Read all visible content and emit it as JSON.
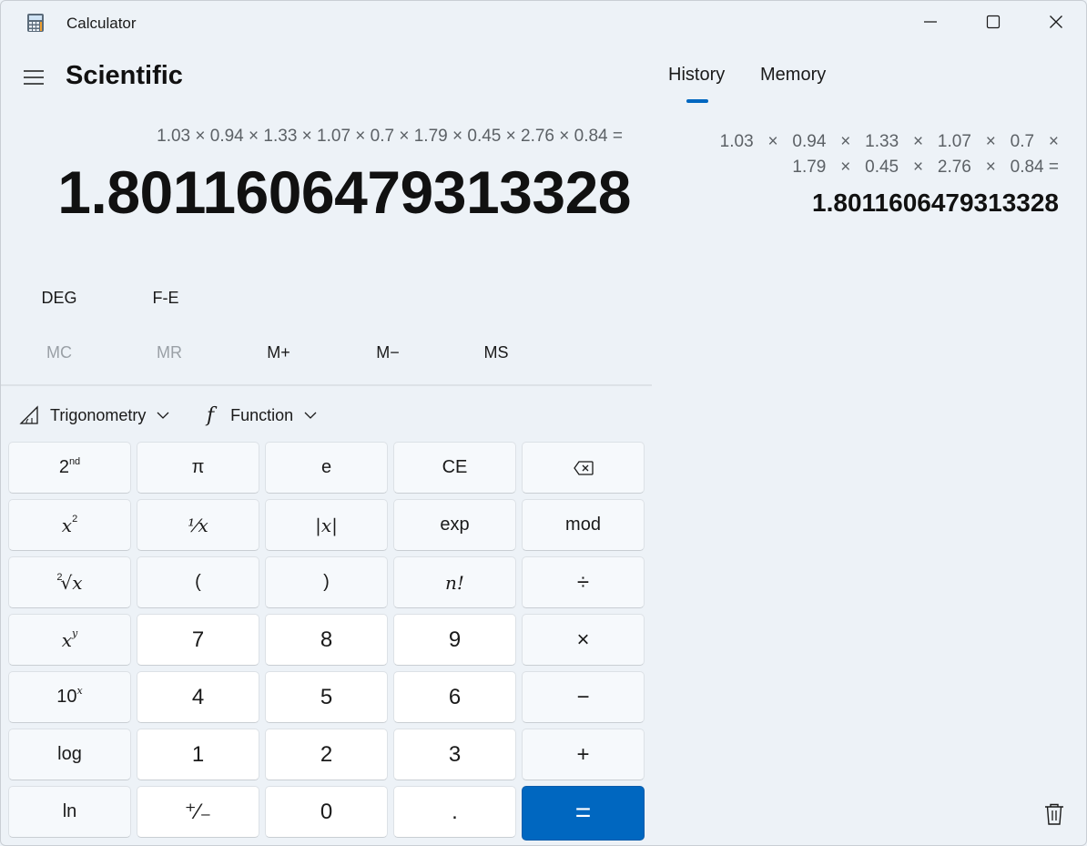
{
  "window": {
    "title": "Calculator",
    "icons": [
      "calculator-icon",
      "minimize-icon",
      "maximize-icon",
      "close-icon"
    ]
  },
  "header": {
    "mode_title": "Scientific",
    "menu_icon": "hamburger-icon"
  },
  "display": {
    "expression": "1.03 × 0.94 × 1.33 × 1.07 × 0.7 × 1.79 × 0.45 × 2.76 × 0.84 =",
    "result": "1.8011606479313328"
  },
  "options": {
    "angle_unit": "DEG",
    "fe": "F-E"
  },
  "memory_buttons": {
    "mc": "MC",
    "mr": "MR",
    "mplus": "M+",
    "mminus": "M−",
    "ms": "MS"
  },
  "function_bar": {
    "trigonometry": "Trigonometry",
    "function": "Function",
    "function_glyph": "f"
  },
  "keypad": {
    "r1": [
      "2nd",
      "π",
      "e",
      "CE",
      "backspace"
    ],
    "r2": [
      "x²",
      "⅟x",
      "|x|",
      "exp",
      "mod"
    ],
    "r3": [
      "²√x",
      "(",
      ")",
      "n!",
      "÷"
    ],
    "r4": [
      "xʸ",
      "7",
      "8",
      "9",
      "×"
    ],
    "r5": [
      "10ˣ",
      "4",
      "5",
      "6",
      "−"
    ],
    "r6": [
      "log",
      "1",
      "2",
      "3",
      "+"
    ],
    "r7": [
      "ln",
      "+/−",
      "0",
      ".",
      "="
    ],
    "labels": {
      "second": "2",
      "second_sup": "nd",
      "pi": "π",
      "e": "e",
      "ce": "CE",
      "x": "x",
      "sq_sup": "2",
      "recip": "⅟x",
      "abs": "|x|",
      "exp": "exp",
      "mod": "mod",
      "root_idx": "2",
      "root": "√x",
      "lparen": "(",
      "rparen": ")",
      "fact": "n!",
      "div": "÷",
      "pow_sup": "y",
      "seven": "7",
      "eight": "8",
      "nine": "9",
      "mul": "×",
      "ten": "10",
      "ten_sup": "x",
      "four": "4",
      "five": "5",
      "six": "6",
      "minus": "−",
      "log": "log",
      "one": "1",
      "two": "2",
      "three": "3",
      "plus": "+",
      "ln": "ln",
      "negate": "⁺∕₋",
      "zero": "0",
      "dot": ".",
      "equals": "="
    }
  },
  "history_panel": {
    "tab_history": "History",
    "tab_memory": "Memory",
    "active_tab": "History",
    "entry_line1": "1.03   ×   0.94   ×   1.33   ×   1.07   ×   0.7   ×",
    "entry_line2": "1.79   ×   0.45   ×   2.76   ×   0.84 =",
    "entry_result": "1.8011606479313328"
  },
  "colors": {
    "accent": "#0067c0",
    "background": "#edf2f7",
    "key_bg": "#f6f9fc",
    "num_key_bg": "#ffffff"
  }
}
